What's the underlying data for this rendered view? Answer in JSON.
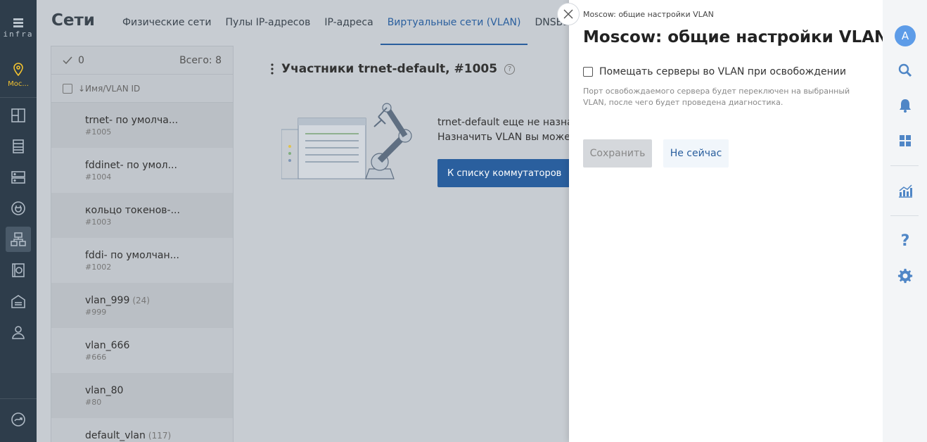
{
  "leftbar": {
    "logo_text": "infra",
    "location_label": "Moc...",
    "icons": [
      "dashboard-icon",
      "server-rack-icon",
      "servers-icon",
      "plug-icon",
      "network-icon",
      "storage-icon",
      "warehouse-icon",
      "user-icon"
    ],
    "bottom_icon": "expand-icon"
  },
  "header": {
    "title": "Сети",
    "tabs": [
      {
        "label": "Физические сети"
      },
      {
        "label": "Пулы IP-адресов"
      },
      {
        "label": "IP-адреса"
      },
      {
        "label": "Виртуальные сети (VLAN)",
        "active": true
      },
      {
        "label": "DNSBL"
      }
    ]
  },
  "list": {
    "selected_count": "0",
    "total_label": "Всего: 8",
    "column_header": "↓Имя/VLAN ID",
    "rows": [
      {
        "name": "trnet- по умолча...",
        "count": "",
        "id": "#1005"
      },
      {
        "name": "fddinet- по умол...",
        "count": "",
        "id": "#1004"
      },
      {
        "name": "кольцо токенов-...",
        "count": "",
        "id": "#1003"
      },
      {
        "name": "fddi- по умолчан...",
        "count": "",
        "id": "#1002"
      },
      {
        "name": "vlan_999",
        "count": "(24)",
        "id": "#999"
      },
      {
        "name": "vlan_666",
        "count": "",
        "id": "#666"
      },
      {
        "name": "vlan_80",
        "count": "",
        "id": "#80"
      },
      {
        "name": "default_vlan",
        "count": "(117)",
        "id": ""
      }
    ]
  },
  "detail": {
    "title": "Участники trnet-default, #1005",
    "help": "?",
    "empty_line1": "trnet-default еще не назначе",
    "empty_line2": "Назначить VLAN вы можете",
    "button_label": "К списку коммутаторов"
  },
  "drawer": {
    "breadcrumb": "Moscow: общие настройки VLAN",
    "title": "Moscow: общие настройки VLAN",
    "checkbox_label": "Помещать серверы во VLAN при освобождении",
    "checkbox_checked": false,
    "hint": "Порт освобождаемого сервера будет переключен на выбранный VLAN, после чего будет проведена диагностика.",
    "save_label": "Сохранить",
    "later_label": "Не сейчас"
  },
  "rightbar": {
    "avatar": "A",
    "icons": [
      "search-icon",
      "bell-icon",
      "apps-grid-icon",
      "chart-icon",
      "help-icon",
      "gear-icon"
    ]
  },
  "colors": {
    "sidebar_bg": "#2e3d4b",
    "accent": "#2a5f9e",
    "location_accent": "#f2c230",
    "avatar_bg": "#5d9ce8"
  }
}
